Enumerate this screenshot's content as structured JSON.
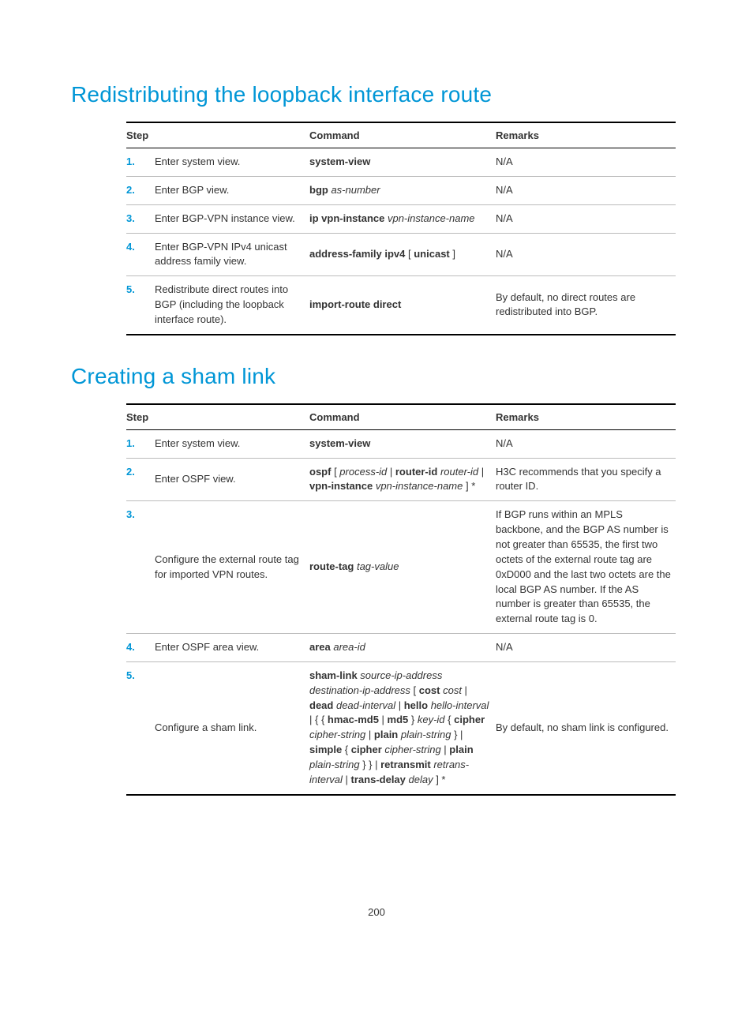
{
  "heading1": "Redistributing the loopback interface route",
  "heading2": "Creating a sham link",
  "headers": {
    "step": "Step",
    "command": "Command",
    "remarks": "Remarks"
  },
  "page_number": "200",
  "table1": {
    "rows": [
      {
        "n": "1.",
        "step": "Enter system view.",
        "cmd": [
          {
            "t": "system-view",
            "b": true
          }
        ],
        "rem": [
          {
            "t": "N/A"
          }
        ]
      },
      {
        "n": "2.",
        "step": "Enter BGP view.",
        "cmd": [
          {
            "t": "bgp ",
            "b": true
          },
          {
            "t": "as-number",
            "i": true
          }
        ],
        "rem": [
          {
            "t": "N/A"
          }
        ]
      },
      {
        "n": "3.",
        "step": "Enter BGP-VPN instance view.",
        "cmd": [
          {
            "t": "ip vpn-instance ",
            "b": true
          },
          {
            "t": "vpn-instance-name",
            "i": true
          }
        ],
        "rem": [
          {
            "t": "N/A"
          }
        ]
      },
      {
        "n": "4.",
        "step": "Enter BGP-VPN IPv4 unicast address family view.",
        "cmd": [
          {
            "t": "address-family ipv4",
            "b": true
          },
          {
            "t": " [ "
          },
          {
            "t": "unicast",
            "b": true
          },
          {
            "t": " ]"
          }
        ],
        "rem": [
          {
            "t": "N/A"
          }
        ]
      },
      {
        "n": "5.",
        "step": "Redistribute direct routes into BGP (including the loopback interface route).",
        "cmd": [
          {
            "t": "import-route direct",
            "b": true
          }
        ],
        "rem": [
          {
            "t": "By default, no direct routes are redistributed into BGP."
          }
        ]
      }
    ]
  },
  "table2": {
    "rows": [
      {
        "n": "1.",
        "step": "Enter system view.",
        "cmd": [
          {
            "t": "system-view",
            "b": true
          }
        ],
        "rem": [
          {
            "t": "N/A"
          }
        ]
      },
      {
        "n": "2.",
        "step": "Enter OSPF view.",
        "cmd": [
          {
            "t": "ospf",
            "b": true
          },
          {
            "t": " [ "
          },
          {
            "t": "process-id",
            "i": true
          },
          {
            "t": " | "
          },
          {
            "t": "router-id",
            "b": true
          },
          {
            "t": " "
          },
          {
            "t": "router-id",
            "i": true
          },
          {
            "t": " | "
          },
          {
            "t": "vpn-instance",
            "b": true
          },
          {
            "t": " "
          },
          {
            "t": "vpn-instance-name",
            "i": true
          },
          {
            "t": " ] *"
          }
        ],
        "rem": [
          {
            "t": "H3C recommends that you specify a router ID."
          }
        ]
      },
      {
        "n": "3.",
        "step": "Configure the external route tag for imported VPN routes.",
        "cmd": [
          {
            "t": "route-tag ",
            "b": true
          },
          {
            "t": "tag-value",
            "i": true
          }
        ],
        "rem": [
          {
            "t": "If BGP runs within an MPLS backbone, and the BGP AS number is not greater than 65535, the first two octets of the external route tag are 0xD000 and the last two octets are the local BGP AS number. If the AS number is greater than 65535, the external route tag is 0."
          }
        ]
      },
      {
        "n": "4.",
        "step": "Enter OSPF area view.",
        "cmd": [
          {
            "t": "area ",
            "b": true
          },
          {
            "t": "area-id",
            "i": true
          }
        ],
        "rem": [
          {
            "t": "N/A"
          }
        ]
      },
      {
        "n": "5.",
        "step": "Configure a sham link.",
        "cmd": [
          {
            "t": "sham-link ",
            "b": true
          },
          {
            "t": "source-ip-address destination-ip-address",
            "i": true
          },
          {
            "t": " [ "
          },
          {
            "t": "cost ",
            "b": true
          },
          {
            "t": "cost",
            "i": true
          },
          {
            "t": " | "
          },
          {
            "t": "dead ",
            "b": true
          },
          {
            "t": "dead-interval",
            "i": true
          },
          {
            "t": " | "
          },
          {
            "t": "hello ",
            "b": true
          },
          {
            "t": "hello-interval",
            "i": true
          },
          {
            "t": " | { { "
          },
          {
            "t": "hmac-md5",
            "b": true
          },
          {
            "t": " | "
          },
          {
            "t": "md5",
            "b": true
          },
          {
            "t": " } "
          },
          {
            "t": "key-id",
            "i": true
          },
          {
            "t": " { "
          },
          {
            "t": "cipher ",
            "b": true
          },
          {
            "t": "cipher-string",
            "i": true
          },
          {
            "t": " | "
          },
          {
            "t": "plain ",
            "b": true
          },
          {
            "t": "plain-string",
            "i": true
          },
          {
            "t": " } | "
          },
          {
            "t": "simple",
            "b": true
          },
          {
            "t": " { "
          },
          {
            "t": "cipher ",
            "b": true
          },
          {
            "t": "cipher-string",
            "i": true
          },
          {
            "t": " | "
          },
          {
            "t": "plain ",
            "b": true
          },
          {
            "t": "plain-string",
            "i": true
          },
          {
            "t": " } } | "
          },
          {
            "t": "retransmit ",
            "b": true
          },
          {
            "t": "retrans-interval",
            "i": true
          },
          {
            "t": " | "
          },
          {
            "t": "trans-delay ",
            "b": true
          },
          {
            "t": "delay",
            "i": true
          },
          {
            "t": " ] *"
          }
        ],
        "rem": [
          {
            "t": "By default, no sham link is configured."
          }
        ]
      }
    ]
  }
}
